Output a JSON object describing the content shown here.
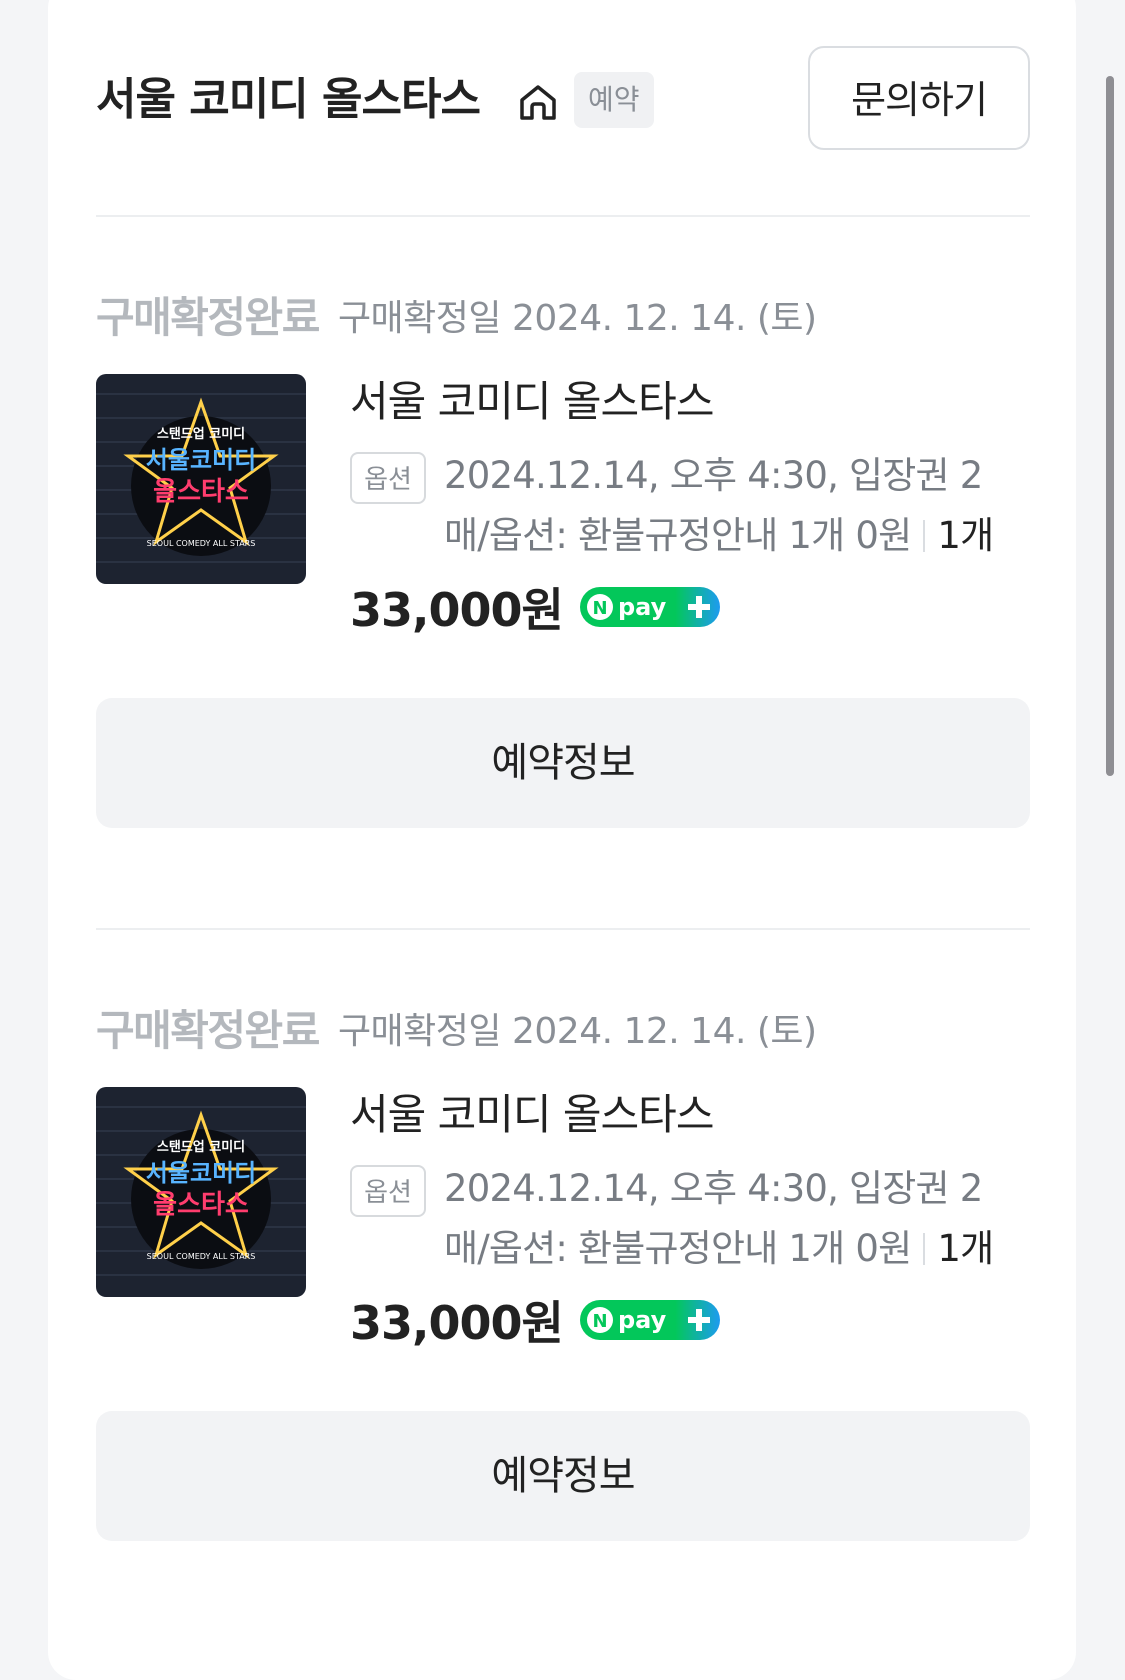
{
  "header": {
    "store_title": "서울 코미디 올스타스",
    "booking_tag": "예약",
    "inquiry_button": "문의하기"
  },
  "orders": [
    {
      "status": "구매확정완료",
      "status_date": "구매확정일 2024. 12. 14. (토)",
      "product_name": "서울 코미디 올스타스",
      "option_tag": "옵션",
      "option_text": "2024.12.14, 오후 4:30, 입장권 2매/옵션: 환불규정안내 1개 0원",
      "option_qty": "1개",
      "price": "33,000원",
      "pay_badge": "pay",
      "pay_badge_letter": "N",
      "reserve_button": "예약정보"
    },
    {
      "status": "구매확정완료",
      "status_date": "구매확정일 2024. 12. 14. (토)",
      "product_name": "서울 코미디 올스타스",
      "option_tag": "옵션",
      "option_text": "2024.12.14, 오후 4:30, 입장권 2매/옵션: 환불규정안내 1개 0원",
      "option_qty": "1개",
      "price": "33,000원",
      "pay_badge": "pay",
      "pay_badge_letter": "N",
      "reserve_button": "예약정보"
    }
  ],
  "poster": {
    "top_text": "스탠드업 코미디",
    "main_text_1": "서울코미디",
    "main_text_2": "올스타스",
    "bottom_text": "SEOUL COMEDY ALL STARS"
  },
  "colors": {
    "npay_green": "#03c75a",
    "npay_blue": "#1e9bf0",
    "neon_pink": "#ff3d6e",
    "neon_blue": "#58b4ff",
    "neon_yellow": "#ffd04a"
  },
  "icons": {
    "home": "home-icon",
    "plus": "plus-icon"
  }
}
